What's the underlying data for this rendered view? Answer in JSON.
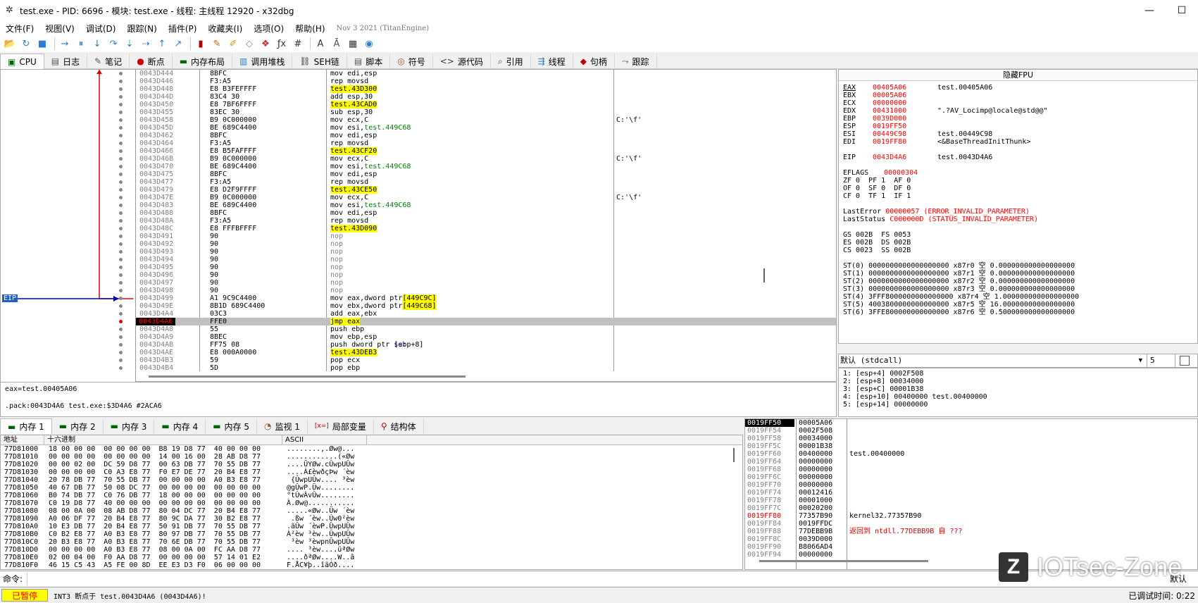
{
  "window": {
    "title": "test.exe - PID: 6696 - 模块: test.exe - 线程: 主线程 12920 - x32dbg",
    "minimize": "—",
    "maximize": "☐"
  },
  "menu": {
    "items": [
      "文件(F)",
      "视图(V)",
      "调试(D)",
      "跟踪(N)",
      "插件(P)",
      "收藏夹(I)",
      "选项(O)",
      "帮助(H)"
    ],
    "version": "Nov 3 2021 (TitanEngine)"
  },
  "toolbar": {
    "icons": [
      "open-icon",
      "restart-icon",
      "stop-icon",
      "run-icon",
      "pause-icon",
      "step-into-icon",
      "step-over-icon",
      "trace-into-icon",
      "trace-over-icon",
      "execute-till-return-icon",
      "run-to-user-code-icon",
      "scylla-icon",
      "patch-icon",
      "comment-icon",
      "label-icon",
      "bookmark-icon",
      "function-icon",
      "hash-icon",
      "font-icon",
      "strings-icon",
      "calculator-icon",
      "cpu-info-icon"
    ],
    "glyphs": [
      "📂",
      "↻",
      "■",
      "→",
      "⏸",
      "↓",
      "↷",
      "⇣",
      "⇢",
      "↑",
      "↗",
      "▮",
      "✎",
      "✐",
      "◇",
      "❖",
      "ƒx",
      "#",
      "A",
      "Ā",
      "▦",
      "◉"
    ],
    "colors": [
      "#d9a520",
      "#2a7fd4",
      "#2a7fd4",
      "#2a7fd4",
      "#2a7fd4",
      "#2a7fd4",
      "#2a7fd4",
      "#2a7fd4",
      "#2a7fd4",
      "#2a7fd4",
      "#2a7fd4",
      "#b00000",
      "#cc6600",
      "#cc9900",
      "#6a8fc9",
      "#d02020",
      "#333333",
      "#333333",
      "#333333",
      "#555555",
      "#333333",
      "#2a7fd4"
    ]
  },
  "tabs": [
    {
      "label": "CPU",
      "icon": "cpu-icon",
      "glyph": "▣"
    },
    {
      "label": "日志",
      "icon": "log-icon",
      "glyph": "▤"
    },
    {
      "label": "笔记",
      "icon": "notes-icon",
      "glyph": "✎"
    },
    {
      "label": "断点",
      "icon": "breakpoint-icon",
      "glyph": "●"
    },
    {
      "label": "内存布局",
      "icon": "memory-map-icon",
      "glyph": "▬"
    },
    {
      "label": "调用堆栈",
      "icon": "call-stack-icon",
      "glyph": "▥"
    },
    {
      "label": "SEH链",
      "icon": "seh-icon",
      "glyph": "⛓"
    },
    {
      "label": "脚本",
      "icon": "script-icon",
      "glyph": "▤"
    },
    {
      "label": "符号",
      "icon": "symbols-icon",
      "glyph": "◎"
    },
    {
      "label": "源代码",
      "icon": "source-icon",
      "glyph": "<>"
    },
    {
      "label": "引用",
      "icon": "references-icon",
      "glyph": "⌕"
    },
    {
      "label": "线程",
      "icon": "threads-icon",
      "glyph": "⇶"
    },
    {
      "label": "句柄",
      "icon": "handles-icon",
      "glyph": "◆"
    },
    {
      "label": "跟踪",
      "icon": "trace-icon",
      "glyph": "⤳"
    }
  ],
  "disasm": {
    "eip_label": "EIP",
    "rows": [
      {
        "addr": "0043D444",
        "bytes": "8BFC",
        "asm": "mov edi,esp",
        "cmt": ""
      },
      {
        "addr": "0043D446",
        "bytes": "F3:A5",
        "asm": "rep movsd",
        "cmt": ""
      },
      {
        "addr": "0043D448",
        "bytes": "E8 B3FEFFFF",
        "asm": "call test.43D300",
        "call": true,
        "cmt": ""
      },
      {
        "addr": "0043D44D",
        "bytes": "83C4 30",
        "asm": "add esp,30",
        "cmt": ""
      },
      {
        "addr": "0043D450",
        "bytes": "E8 7BF6FFFF",
        "asm": "call test.43CAD0",
        "call": true,
        "cmt": ""
      },
      {
        "addr": "0043D455",
        "bytes": "83EC 30",
        "asm": "sub esp,30",
        "cmt": ""
      },
      {
        "addr": "0043D458",
        "bytes": "B9 0C000000",
        "asm": "mov ecx,C",
        "cmt": "C:'\\f'"
      },
      {
        "addr": "0043D45D",
        "bytes": "BE 689C4400",
        "asm": "mov esi,test.449C68",
        "cmt": ""
      },
      {
        "addr": "0043D462",
        "bytes": "8BFC",
        "asm": "mov edi,esp",
        "cmt": ""
      },
      {
        "addr": "0043D464",
        "bytes": "F3:A5",
        "asm": "rep movsd",
        "cmt": ""
      },
      {
        "addr": "0043D466",
        "bytes": "E8 B5FAFFFF",
        "asm": "call test.43CF20",
        "call": true,
        "cmt": ""
      },
      {
        "addr": "0043D46B",
        "bytes": "B9 0C000000",
        "asm": "mov ecx,C",
        "cmt": "C:'\\f'"
      },
      {
        "addr": "0043D470",
        "bytes": "BE 689C4400",
        "asm": "mov esi,test.449C68",
        "cmt": ""
      },
      {
        "addr": "0043D475",
        "bytes": "8BFC",
        "asm": "mov edi,esp",
        "cmt": ""
      },
      {
        "addr": "0043D477",
        "bytes": "F3:A5",
        "asm": "rep movsd",
        "cmt": ""
      },
      {
        "addr": "0043D479",
        "bytes": "E8 D2F9FFFF",
        "asm": "call test.43CE50",
        "call": true,
        "cmt": ""
      },
      {
        "addr": "0043D47E",
        "bytes": "B9 0C000000",
        "asm": "mov ecx,C",
        "cmt": "C:'\\f'"
      },
      {
        "addr": "0043D483",
        "bytes": "BE 689C4400",
        "asm": "mov esi,test.449C68",
        "cmt": ""
      },
      {
        "addr": "0043D488",
        "bytes": "8BFC",
        "asm": "mov edi,esp",
        "cmt": ""
      },
      {
        "addr": "0043D48A",
        "bytes": "F3:A5",
        "asm": "rep movsd",
        "cmt": ""
      },
      {
        "addr": "0043D48C",
        "bytes": "E8 FFFBFFFF",
        "asm": "call test.43D090",
        "call": true,
        "cmt": ""
      },
      {
        "addr": "0043D491",
        "bytes": "90",
        "asm": "nop",
        "cmt": ""
      },
      {
        "addr": "0043D492",
        "bytes": "90",
        "asm": "nop",
        "cmt": ""
      },
      {
        "addr": "0043D493",
        "bytes": "90",
        "asm": "nop",
        "cmt": ""
      },
      {
        "addr": "0043D494",
        "bytes": "90",
        "asm": "nop",
        "cmt": ""
      },
      {
        "addr": "0043D495",
        "bytes": "90",
        "asm": "nop",
        "cmt": ""
      },
      {
        "addr": "0043D496",
        "bytes": "90",
        "asm": "nop",
        "cmt": ""
      },
      {
        "addr": "0043D497",
        "bytes": "90",
        "asm": "nop",
        "cmt": ""
      },
      {
        "addr": "0043D498",
        "bytes": "90",
        "asm": "nop",
        "cmt": ""
      },
      {
        "addr": "0043D499",
        "bytes": "A1 9C9C4400",
        "asm": "mov eax,dword ptr ds:[449C9C]",
        "cmt": ""
      },
      {
        "addr": "0043D49E",
        "bytes": "8B1D 689C4400",
        "asm": "mov ebx,dword ptr ds:[449C68]",
        "cmt": ""
      },
      {
        "addr": "0043D4A4",
        "bytes": "03C3",
        "asm": "add eax,ebx",
        "cmt": ""
      },
      {
        "addr": "0043D4A6",
        "bytes": "FFE0",
        "asm": "jmp eax",
        "cur": true,
        "cmt": ""
      },
      {
        "addr": "0043D4A8",
        "bytes": "55",
        "asm": "push ebp",
        "cmt": ""
      },
      {
        "addr": "0043D4A9",
        "bytes": "8BEC",
        "asm": "mov ebp,esp",
        "cmt": ""
      },
      {
        "addr": "0043D4AB",
        "bytes": "FF75 08",
        "asm": "push dword ptr ss:[ebp+8]",
        "cmt": ""
      },
      {
        "addr": "0043D4AE",
        "bytes": "E8 000A0000",
        "asm": "call test.43DEB3",
        "call": true,
        "cmt": ""
      },
      {
        "addr": "0043D4B3",
        "bytes": "59",
        "asm": "pop ecx",
        "cmt": ""
      },
      {
        "addr": "0043D4B4",
        "bytes": "5D",
        "asm": "pop ebp",
        "cmt": ""
      }
    ]
  },
  "fpu_header": "隐藏FPU",
  "registers": [
    {
      "name": "EAX",
      "val": "00405A06",
      "desc": "test.00405A06"
    },
    {
      "name": "EBX",
      "val": "00005A06",
      "desc": ""
    },
    {
      "name": "ECX",
      "val": "00000000",
      "desc": ""
    },
    {
      "name": "EDX",
      "val": "00431000",
      "desc": "\".?AV_Locimp@locale@std@@\""
    },
    {
      "name": "EBP",
      "val": "0039D000",
      "desc": ""
    },
    {
      "name": "ESP",
      "val": "0019FF50",
      "desc": ""
    },
    {
      "name": "ESI",
      "val": "00449C98",
      "desc": "test.00449C98"
    },
    {
      "name": "EDI",
      "val": "0019FF80",
      "desc": "<&BaseThreadInitThunk>"
    },
    {
      "name": "",
      "val": "",
      "desc": ""
    },
    {
      "name": "EIP",
      "val": "0043D4A6",
      "desc": "test.0043D4A6"
    },
    {
      "name": "",
      "val": "",
      "desc": ""
    },
    {
      "name": "EFLAGS",
      "val": "00000304",
      "desc": ""
    }
  ],
  "flags": [
    "ZF 0  PF 1  AF 0",
    "OF 0  SF 0  DF 0",
    "CF 0  TF 1  IF 1"
  ],
  "lasterror": {
    "label": "LastError",
    "val": "00000057 (ERROR_INVALID_PARAMETER)"
  },
  "laststatus": {
    "label": "LastStatus",
    "val": "C000000D (STATUS_INVALID_PARAMETER)"
  },
  "segs": [
    "GS 002B  FS 0053",
    "ES 002B  DS 002B",
    "CS 0023  SS 002B"
  ],
  "fpu": [
    "ST(0) 0000000000000000000 x87r0 空 0.000000000000000000",
    "ST(1) 0000000000000000000 x87r1 空 0.000000000000000000",
    "ST(2) 0000000000000000000 x87r2 空 0.000000000000000000",
    "ST(3) 0000000000000000000 x87r3 空 0.000000000000000000",
    "ST(4) 3FFF8000000000000000 x87r4 空 1.000000000000000000",
    "ST(5) 4003800000000000000 x87r5 空 16.00000000000000000",
    "ST(6) 3FFE800000000000000 x87r6 空 0.500000000000000000"
  ],
  "callconv": {
    "selected": "默认 (stdcall)",
    "count": "5"
  },
  "stackargs": [
    "1: [esp+4] 0002F508",
    "2: [esp+8] 00034000",
    "3: [esp+C] 00001B38",
    "4: [esp+10] 00400000 test.00400000",
    "5: [esp+14] 00000000"
  ],
  "info": {
    "line1": "eax=test.00405A06",
    "line2": ".pack:0043D4A6 test.exe:$3D4A6 #2ACA6"
  },
  "memtabs": [
    {
      "label": "内存 1",
      "icon": "memory-icon",
      "glyph": "▬"
    },
    {
      "label": "内存 2",
      "icon": "memory-icon",
      "glyph": "▬"
    },
    {
      "label": "内存 3",
      "icon": "memory-icon",
      "glyph": "▬"
    },
    {
      "label": "内存 4",
      "icon": "memory-icon",
      "glyph": "▬"
    },
    {
      "label": "内存 5",
      "icon": "memory-icon",
      "glyph": "▬"
    },
    {
      "label": "监视 1",
      "icon": "watch-icon",
      "glyph": "◔"
    },
    {
      "label": "局部变量",
      "icon": "locals-icon",
      "glyph": "[x=]"
    },
    {
      "label": "结构体",
      "icon": "struct-icon",
      "glyph": "⚲"
    }
  ],
  "dump": {
    "col_addr": "地址",
    "col_hex": "十六进制",
    "col_ascii": "ASCII",
    "rows": [
      {
        "a": "77D81000",
        "h": "18 00 00 00  00 00 00 00  B8 19 D8 77  40 00 00 00",
        "c": "........,.Øw@..."
      },
      {
        "a": "77D81010",
        "h": "00 00 00 00  00 00 00 00  14 00 16 00  28 AB D8 77",
        "c": "............(«Øw"
      },
      {
        "a": "77D81020",
        "h": "00 00 02 00  DC 59 D8 77  00 63 DB 77  70 55 DB 77",
        "c": "....ÜYØw.cÛwpUÛw"
      },
      {
        "a": "77D81030",
        "h": "00 00 00 00  C0 A3 E8 77  F0 E7 DE 77  20 B4 E8 77",
        "c": "....À£èwðçÞw ´èw"
      },
      {
        "a": "77D81040",
        "h": "20 78 DB 77  70 55 DB 77  00 00 00 00  A0 B3 E8 77",
        "c": " {ÛwpUÛw.... ³èw"
      },
      {
        "a": "77D81050",
        "h": "40 67 DB 77  50 08 DC 77  00 00 00 00  00 00 00 00",
        "c": "@gÛwP.Üw........"
      },
      {
        "a": "77D81060",
        "h": "B0 74 DB 77  C0 76 DB 77  18 00 00 00  00 00 00 00",
        "c": "°tÛwÀvÛw........"
      },
      {
        "a": "77D81070",
        "h": "C0 19 D8 77  40 00 00 00  00 00 00 00  00 00 00 00",
        "c": "À.Øw@..........."
      },
      {
        "a": "77D81080",
        "h": "08 00 0A 00  08 AB D8 77  80 04 DC 77  20 B4 E8 77",
        "c": ".....«Øw..Üw ´èw"
      },
      {
        "a": "77D81090",
        "h": "A0 06 DF 77  20 B4 E8 77  80 9C DA 77  30 B2 E8 77",
        "c": " .ßw ´èw..Úw0²èw"
      },
      {
        "a": "77D810A0",
        "h": "10 E3 DB 77  20 B4 E8 77  50 91 DB 77  70 55 DB 77",
        "c": ".ãÛw ´èwP.ÛwpUÛw"
      },
      {
        "a": "77D810B0",
        "h": "C0 B2 E8 77  A0 B3 E8 77  80 97 DB 77  70 55 DB 77",
        "c": "À²èw ³èw..ÛwpUÛw"
      },
      {
        "a": "77D810C0",
        "h": "20 B3 E8 77  A0 B3 E8 77  70 6E DB 77  70 55 DB 77",
        "c": " ³èw ³èwpnÛwpUÛw"
      },
      {
        "a": "77D810D0",
        "h": "00 00 00 00  A0 B3 E8 77  08 00 0A 00  FC AA D8 77",
        "c": ".... ³èw....üªØw"
      },
      {
        "a": "77D810E0",
        "h": "02 00 04 00  F0 AA D8 77  00 00 00 00  57 14 01 E2",
        "c": "....ðªØw....W..â"
      },
      {
        "a": "77D810F0",
        "h": "46 15 C5 43  A5 FE 00 8D  EE E3 D3 F0  06 00 00 00",
        "c": "F.ÅC¥þ..îãÓð...."
      }
    ]
  },
  "stack": [
    {
      "a": "0019FF50",
      "v": "00005A06",
      "c": "",
      "top": true
    },
    {
      "a": "0019FF54",
      "v": "0002F508",
      "c": ""
    },
    {
      "a": "0019FF58",
      "v": "00034000",
      "c": ""
    },
    {
      "a": "0019FF5C",
      "v": "00001B38",
      "c": ""
    },
    {
      "a": "0019FF60",
      "v": "00400000",
      "c": "test.00400000"
    },
    {
      "a": "0019FF64",
      "v": "00000000",
      "c": ""
    },
    {
      "a": "0019FF68",
      "v": "00000000",
      "c": ""
    },
    {
      "a": "0019FF6C",
      "v": "00000000",
      "c": ""
    },
    {
      "a": "0019FF70",
      "v": "00000000",
      "c": ""
    },
    {
      "a": "0019FF74",
      "v": "00012416",
      "c": ""
    },
    {
      "a": "0019FF78",
      "v": "00001000",
      "c": ""
    },
    {
      "a": "0019FF7C",
      "v": "00020200",
      "c": ""
    },
    {
      "a": "0019FF80",
      "v": "77357B90",
      "c": "kernel32.77357B90",
      "red": true
    },
    {
      "a": "0019FF84",
      "v": "0019FFDC",
      "c": ""
    },
    {
      "a": "0019FF88",
      "v": "77DEBB9B",
      "c": "返回到 ntdll.77DEBB9B 自 ???",
      "ret": true
    },
    {
      "a": "0019FF8C",
      "v": "0039D000",
      "c": ""
    },
    {
      "a": "0019FF90",
      "v": "B8066AD4",
      "c": ""
    },
    {
      "a": "0019FF94",
      "v": "00000000",
      "c": ""
    }
  ],
  "cmd": {
    "label": "命令:",
    "right": "默认"
  },
  "status": {
    "paused": "已暂停",
    "msg": "INT3 断点于 test.0043D4A6 (0043D4A6)!",
    "time": "已调试时间: 0:22"
  },
  "watermark": {
    "letter": "Z",
    "text": "IOTsec-Zone"
  }
}
